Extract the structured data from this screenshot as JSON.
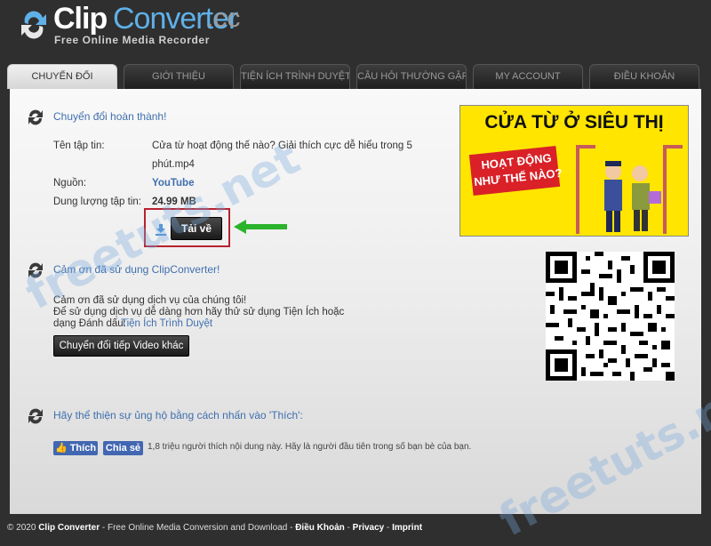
{
  "brand": {
    "clip": "Clip",
    "converter": "Converter",
    "cc": ".cc",
    "tagline": "Free Online Media Recorder"
  },
  "nav": {
    "tabs": [
      "CHUYỂN ĐỔI",
      "GIỚI THIỆU",
      "TIỆN ÍCH TRÌNH DUYỆT",
      "CÂU HỎI THƯỜNG GẶP",
      "MY ACCOUNT",
      "ĐIỀU KHOẢN"
    ],
    "active": 0
  },
  "result": {
    "title": "Chuyển đổi hoàn thành!",
    "filename_label": "Tên tập tin:",
    "filename_line1": "Cửa từ hoạt động thế nào? Giải thích cực dễ hiểu trong 5",
    "filename_line2": "phút.mp4",
    "source_label": "Nguồn:",
    "source_value": "YouTube",
    "size_label": "Dung lượng tập tin:",
    "size_value": "24.99 MB",
    "download_label": "Tải về"
  },
  "thanks": {
    "title": "Cảm ơn đã sử dụng ClipConverter!",
    "line1": "Cảm ơn đã sử dụng dịch vụ của chúng tôi!",
    "line2": "Để sử dụng dịch vụ dễ dàng hơn hãy thử sử dụng Tiện Ích hoặc",
    "line3_prefix": "dạng Đánh dấu:",
    "line3_link": "Tiện Ích Trình Duyệt",
    "convert_again": "Chuyển đổi tiếp Video khác"
  },
  "support": {
    "title": "Hãy thể thiện sự ủng hộ bằng cách nhấn vào 'Thích':",
    "like": "Thích",
    "share": "Chia sẻ",
    "like_text": "1,8 triệu người thích nội dung này. Hãy là người đầu tiên trong số bạn bè của bạn."
  },
  "ad": {
    "title": "CỬA TỪ Ở SIÊU THỊ",
    "line1": "HOẠT ĐỘNG",
    "line2": "NHƯ THẾ NÀO?"
  },
  "watermark": "freetuts.net",
  "footer": {
    "copy": "© 2020",
    "name": "Clip Converter",
    "desc": " - Free Online Media Conversion and Download - ",
    "terms": "Điều Khoản",
    "privacy": "Privacy",
    "imprint": "Imprint",
    "sep": " - "
  },
  "colors": {
    "link": "#3f6fae",
    "highlight": "#b7222f",
    "arrow": "#2bb32b",
    "facebook": "#4267b2"
  }
}
